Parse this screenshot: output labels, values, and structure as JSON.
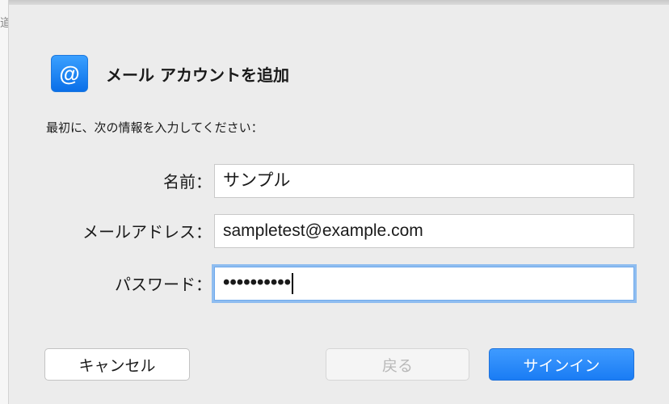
{
  "dialog": {
    "title": "メール アカウントを追加",
    "icon": "at-sign-icon",
    "icon_glyph": "@",
    "subtitle": "最初に、次の情報を入力してください：",
    "fields": {
      "name": {
        "label": "名前：",
        "value": "サンプル"
      },
      "email": {
        "label": "メールアドレス：",
        "value": "sampletest@example.com"
      },
      "password": {
        "label": "パスワード：",
        "value": "••••••••••"
      }
    },
    "buttons": {
      "cancel": "キャンセル",
      "back": "戻る",
      "signin": "サインイン"
    }
  },
  "background": {
    "left_edge_glyph": "道"
  },
  "colors": {
    "accent": "#1a7cf4",
    "focus_ring": "#8fbdf0",
    "window_bg": "#ececec",
    "disabled_text": "#b8b8b8"
  }
}
